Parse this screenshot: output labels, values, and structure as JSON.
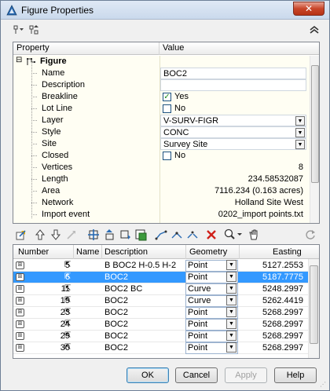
{
  "window": {
    "title": "Figure Properties",
    "close_label": "✕"
  },
  "toolbar": {
    "icons": [
      "filter-icon",
      "sort-icon",
      "collapse-icon"
    ]
  },
  "property_grid": {
    "headers": {
      "property": "Property",
      "value": "Value"
    },
    "category": {
      "expander": "⊟",
      "label": "Figure"
    },
    "rows": [
      {
        "name": "Name",
        "value": "BOC2"
      },
      {
        "name": "Description",
        "value": ""
      },
      {
        "name": "Breakline",
        "checked": true,
        "value": "Yes"
      },
      {
        "name": "Lot Line",
        "checked": false,
        "value": "No"
      },
      {
        "name": "Layer",
        "value": "V-SURV-FIGR"
      },
      {
        "name": "Style",
        "value": "CONC"
      },
      {
        "name": "Site",
        "value": "Survey Site"
      },
      {
        "name": "Closed",
        "checked": false,
        "value": "No"
      },
      {
        "name": "Vertices",
        "value": "8"
      },
      {
        "name": "Length",
        "value": "234.58532087"
      },
      {
        "name": "Area",
        "value": "7116.234 (0.163 acres)"
      },
      {
        "name": "Network",
        "value": "Holland Site West"
      },
      {
        "name": "Import event",
        "value": "0202_import points.txt"
      }
    ]
  },
  "points_toolbar": {
    "icons": [
      "edit-icon",
      "move-up-icon",
      "move-down-icon",
      "arrow-disabled-icon",
      "add-point-icon",
      "insert-point-icon",
      "insert-after-icon",
      "select-icon",
      "link-icon",
      "join-icon",
      "break-icon",
      "delete-icon",
      "zoom-icon",
      "pan-icon",
      "refresh-icon"
    ]
  },
  "points_grid": {
    "headers": [
      "Number",
      "Name",
      "Description",
      "Geometry",
      "Easting"
    ],
    "rows": [
      {
        "number": "5",
        "name": "",
        "description": "B BOC2 H-0.5 H-2",
        "geometry": "Point",
        "easting": "5127.2553",
        "selected": false
      },
      {
        "number": "6",
        "name": "",
        "description": "BOC2",
        "geometry": "Point",
        "easting": "5187.7775",
        "selected": true
      },
      {
        "number": "11",
        "name": "",
        "description": "BOC2 BC",
        "geometry": "Curve",
        "easting": "5248.2997",
        "selected": false
      },
      {
        "number": "19",
        "name": "",
        "description": "BOC2",
        "geometry": "Curve",
        "easting": "5262.4419",
        "selected": false
      },
      {
        "number": "23",
        "name": "",
        "description": "BOC2",
        "geometry": "Point",
        "easting": "5268.2997",
        "selected": false
      },
      {
        "number": "24",
        "name": "",
        "description": "BOC2",
        "geometry": "Point",
        "easting": "5268.2997",
        "selected": false
      },
      {
        "number": "29",
        "name": "",
        "description": "BOC2",
        "geometry": "Point",
        "easting": "5268.2997",
        "selected": false
      },
      {
        "number": "30",
        "name": "",
        "description": "BOC2",
        "geometry": "Point",
        "easting": "5268.2997",
        "selected": false
      }
    ]
  },
  "buttons": {
    "ok": "OK",
    "cancel": "Cancel",
    "apply": "Apply",
    "help": "Help"
  }
}
